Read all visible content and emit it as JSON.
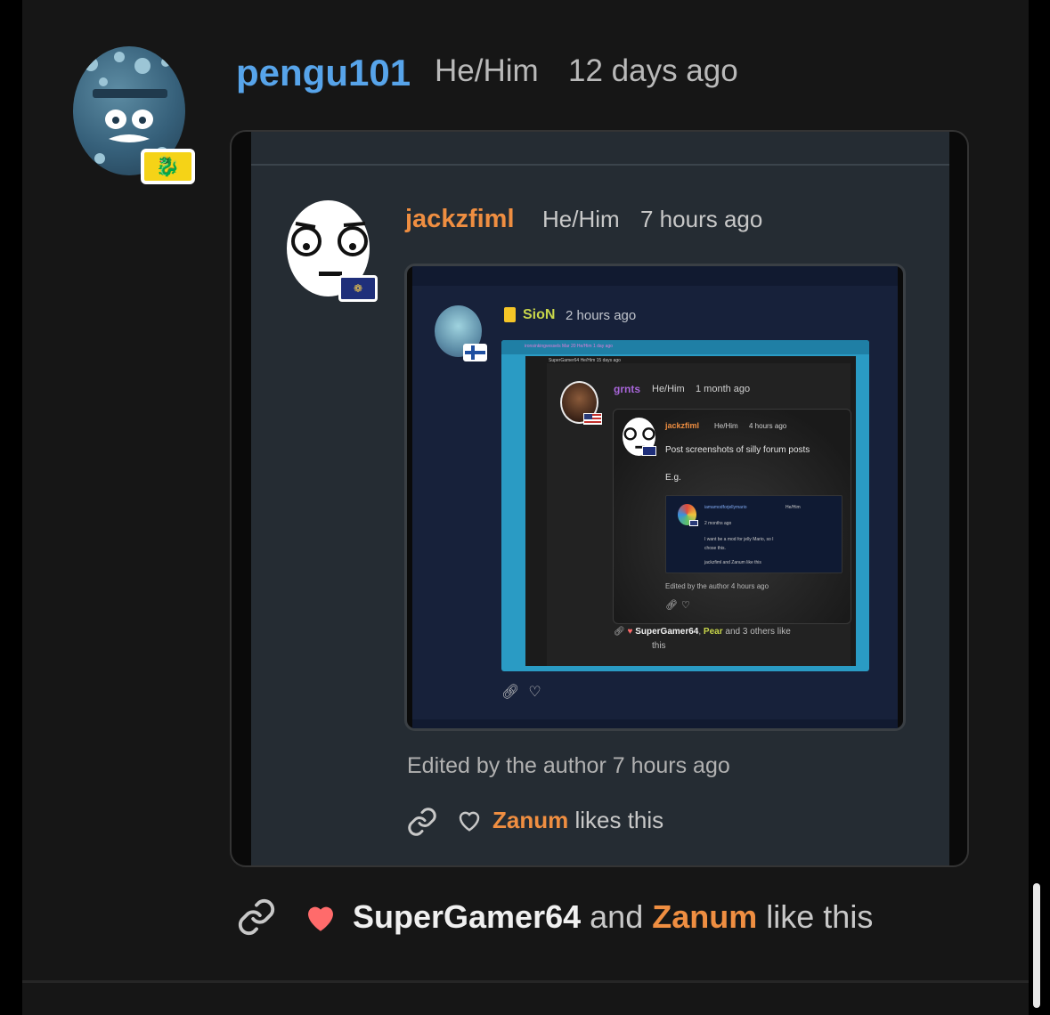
{
  "post": {
    "username": "pengu101",
    "pronouns": "He/Him",
    "time": "12 days ago",
    "likes": {
      "names": [
        "SuperGamer64",
        "Zanum"
      ],
      "joiner": "and",
      "suffix": "like this"
    }
  },
  "quoted": {
    "username": "jackzfiml",
    "pronouns": "He/Him",
    "time": "7 hours ago",
    "edited": "Edited by the author 7 hours ago",
    "likes": {
      "name": "Zanum",
      "suffix": "likes this"
    }
  },
  "nested": {
    "username": "SioN",
    "time": "2 hours ago",
    "deep_header_1": "ironsinkingvessels  Mar 20  He/Him  1 day ago",
    "deep_header_2": "SuperGamer64  He/Him  15 days ago",
    "grnts": {
      "username": "grnts",
      "pronouns": "He/Him",
      "time": "1 month ago"
    },
    "jack2": {
      "username": "jackzfiml",
      "pronouns": "He/Him",
      "time": "4 hours ago",
      "post": "Post screenshots of silly forum posts",
      "eg": "E.g.",
      "edited": "Edited by the author 4 hours ago"
    },
    "mini": {
      "username": "iamamodforjellymario",
      "pronouns": "He/Him",
      "time": "2 months ago",
      "text_1": "I want be a mod for jelly Mario, so I",
      "text_2": "chose this.",
      "likes": "jackzfiml and Zanum like this"
    },
    "grnts_likes": {
      "name1": "SuperGamer64",
      "sep": ",",
      "name2": "Pear",
      "rest": "and 3 others like",
      "rest2": "this"
    }
  },
  "colors": {
    "background": "#161616",
    "accent_blue": "#57a4ea",
    "accent_orange": "#ef8e41",
    "heart_red": "#ff6b6b"
  },
  "icons": {
    "link": "link-icon",
    "heart_filled": "heart-filled-icon",
    "heart_outline": "heart-outline-icon",
    "flag": "flag-icon"
  }
}
